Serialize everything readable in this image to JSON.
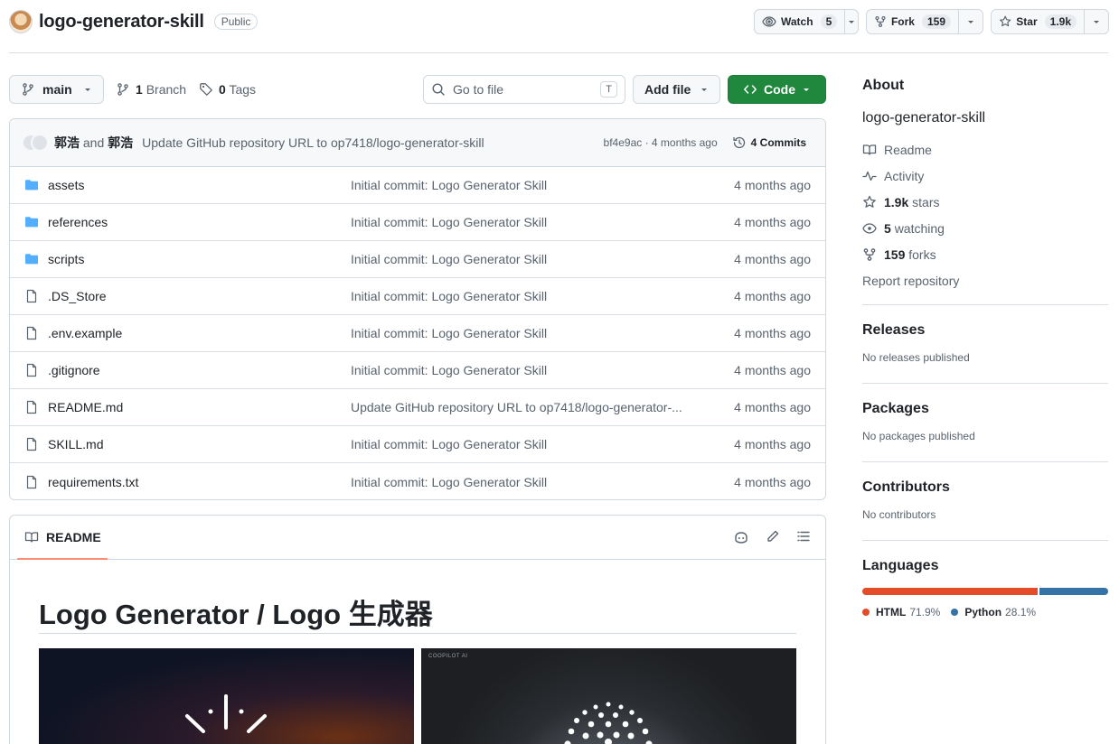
{
  "repo": {
    "name": "logo-generator-skill",
    "visibility": "Public"
  },
  "header_actions": {
    "watch": {
      "label": "Watch",
      "count": "5"
    },
    "fork": {
      "label": "Fork",
      "count": "159"
    },
    "star": {
      "label": "Star",
      "count": "1.9k"
    }
  },
  "toolbar": {
    "branch": "main",
    "branches_count": "1",
    "branches_label": "Branch",
    "tags_count": "0",
    "tags_label": "Tags",
    "goto_placeholder": "Go to file",
    "goto_shortcut": "T",
    "add_file": "Add file",
    "code": "Code"
  },
  "latest_commit": {
    "author1": "郭浩",
    "and": "and",
    "author2": "郭浩",
    "message": "Update GitHub repository URL to op7418/logo-generator-skill",
    "meta": "bf4e9ac · 4 months ago",
    "commits": "4 Commits"
  },
  "files": [
    {
      "type": "dir",
      "name": "assets",
      "commit": "Initial commit: Logo Generator Skill",
      "date": "4 months ago"
    },
    {
      "type": "dir",
      "name": "references",
      "commit": "Initial commit: Logo Generator Skill",
      "date": "4 months ago"
    },
    {
      "type": "dir",
      "name": "scripts",
      "commit": "Initial commit: Logo Generator Skill",
      "date": "4 months ago"
    },
    {
      "type": "file",
      "name": ".DS_Store",
      "commit": "Initial commit: Logo Generator Skill",
      "date": "4 months ago"
    },
    {
      "type": "file",
      "name": ".env.example",
      "commit": "Initial commit: Logo Generator Skill",
      "date": "4 months ago"
    },
    {
      "type": "file",
      "name": ".gitignore",
      "commit": "Initial commit: Logo Generator Skill",
      "date": "4 months ago"
    },
    {
      "type": "file",
      "name": "README.md",
      "commit": "Update GitHub repository URL to op7418/logo-generator-...",
      "date": "4 months ago"
    },
    {
      "type": "file",
      "name": "SKILL.md",
      "commit": "Initial commit: Logo Generator Skill",
      "date": "4 months ago"
    },
    {
      "type": "file",
      "name": "requirements.txt",
      "commit": "Initial commit: Logo Generator Skill",
      "date": "4 months ago"
    }
  ],
  "readme": {
    "tab": "README",
    "title": "Logo Generator / Logo 生成器",
    "image2_caption": "COOPILOT AI"
  },
  "about": {
    "heading": "About",
    "description": "logo-generator-skill",
    "readme": "Readme",
    "activity": "Activity",
    "stars_count": "1.9k",
    "stars_label": "stars",
    "watching_count": "5",
    "watching_label": "watching",
    "forks_count": "159",
    "forks_label": "forks",
    "report": "Report repository"
  },
  "releases": {
    "heading": "Releases",
    "note": "No releases published"
  },
  "packages": {
    "heading": "Packages",
    "note": "No packages published"
  },
  "contributors": {
    "heading": "Contributors",
    "note": "No contributors"
  },
  "languages": {
    "heading": "Languages",
    "items": [
      {
        "name": "HTML",
        "percent": "71.9%",
        "value": 71.9,
        "color": "#e34c26"
      },
      {
        "name": "Python",
        "percent": "28.1%",
        "value": 28.1,
        "color": "#3572a5"
      }
    ]
  },
  "colors": {
    "accent_green": "#1f883d",
    "folder_blue": "#54aeff",
    "tab_underline": "#fd8c73"
  }
}
